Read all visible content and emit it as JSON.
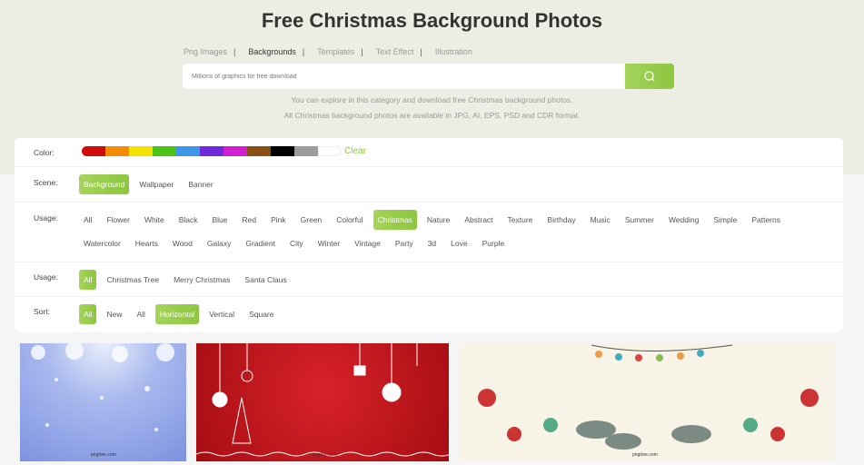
{
  "header": {
    "title": "Free Christmas Background Photos",
    "nav": [
      {
        "label": "Png Images",
        "active": false
      },
      {
        "label": "Backgrounds",
        "active": true
      },
      {
        "label": "Templates",
        "active": false
      },
      {
        "label": "Text Effect",
        "active": false
      },
      {
        "label": "Illustration",
        "active": false
      }
    ],
    "search": {
      "placeholder": "Millions of graphics for free download",
      "value": ""
    },
    "desc1": "You can explore in this category and download free Christmas background photos.",
    "desc2": "All Christmas background photos are available in JPG, AI, EPS, PSD and CDR format."
  },
  "filters": {
    "color": {
      "label": "Color:",
      "swatches": [
        "#d10a0a",
        "#f58a07",
        "#f3e100",
        "#4cc417",
        "#3d97e8",
        "#6f2bdb",
        "#d01ed0",
        "#8a4f13",
        "#000000",
        "#9b9b9b",
        "#ffffff"
      ],
      "clear": "Clear"
    },
    "scene": {
      "label": "Scene:",
      "options": [
        "Background",
        "Wallpaper",
        "Banner"
      ],
      "selected": "Background"
    },
    "usage": {
      "label": "Usage:",
      "options": [
        "All",
        "Flower",
        "White",
        "Black",
        "Blue",
        "Red",
        "Pink",
        "Green",
        "Colorful",
        "Christmas",
        "Nature",
        "Abstract",
        "Texture",
        "Birthday",
        "Music",
        "Summer",
        "Wedding",
        "Simple",
        "Patterns",
        "Watercolor",
        "Hearts",
        "Wood",
        "Galaxy",
        "Gradient",
        "City",
        "Winter",
        "Vintage",
        "Party",
        "3d",
        "Love",
        "Purple"
      ],
      "selected": "Christmas"
    },
    "usage2": {
      "label": "Usage:",
      "options": [
        "All",
        "Christmas Tree",
        "Merry Christmas",
        "Santa Claus"
      ],
      "selected": "All"
    },
    "sort": {
      "label": "Sort:",
      "options": [
        "All",
        "New",
        "All",
        "Horizontal",
        "Vertical",
        "Square"
      ],
      "selected": [
        0,
        3
      ]
    }
  },
  "results": {
    "watermark": "pngtree.com"
  },
  "accent": "#8dc63f"
}
